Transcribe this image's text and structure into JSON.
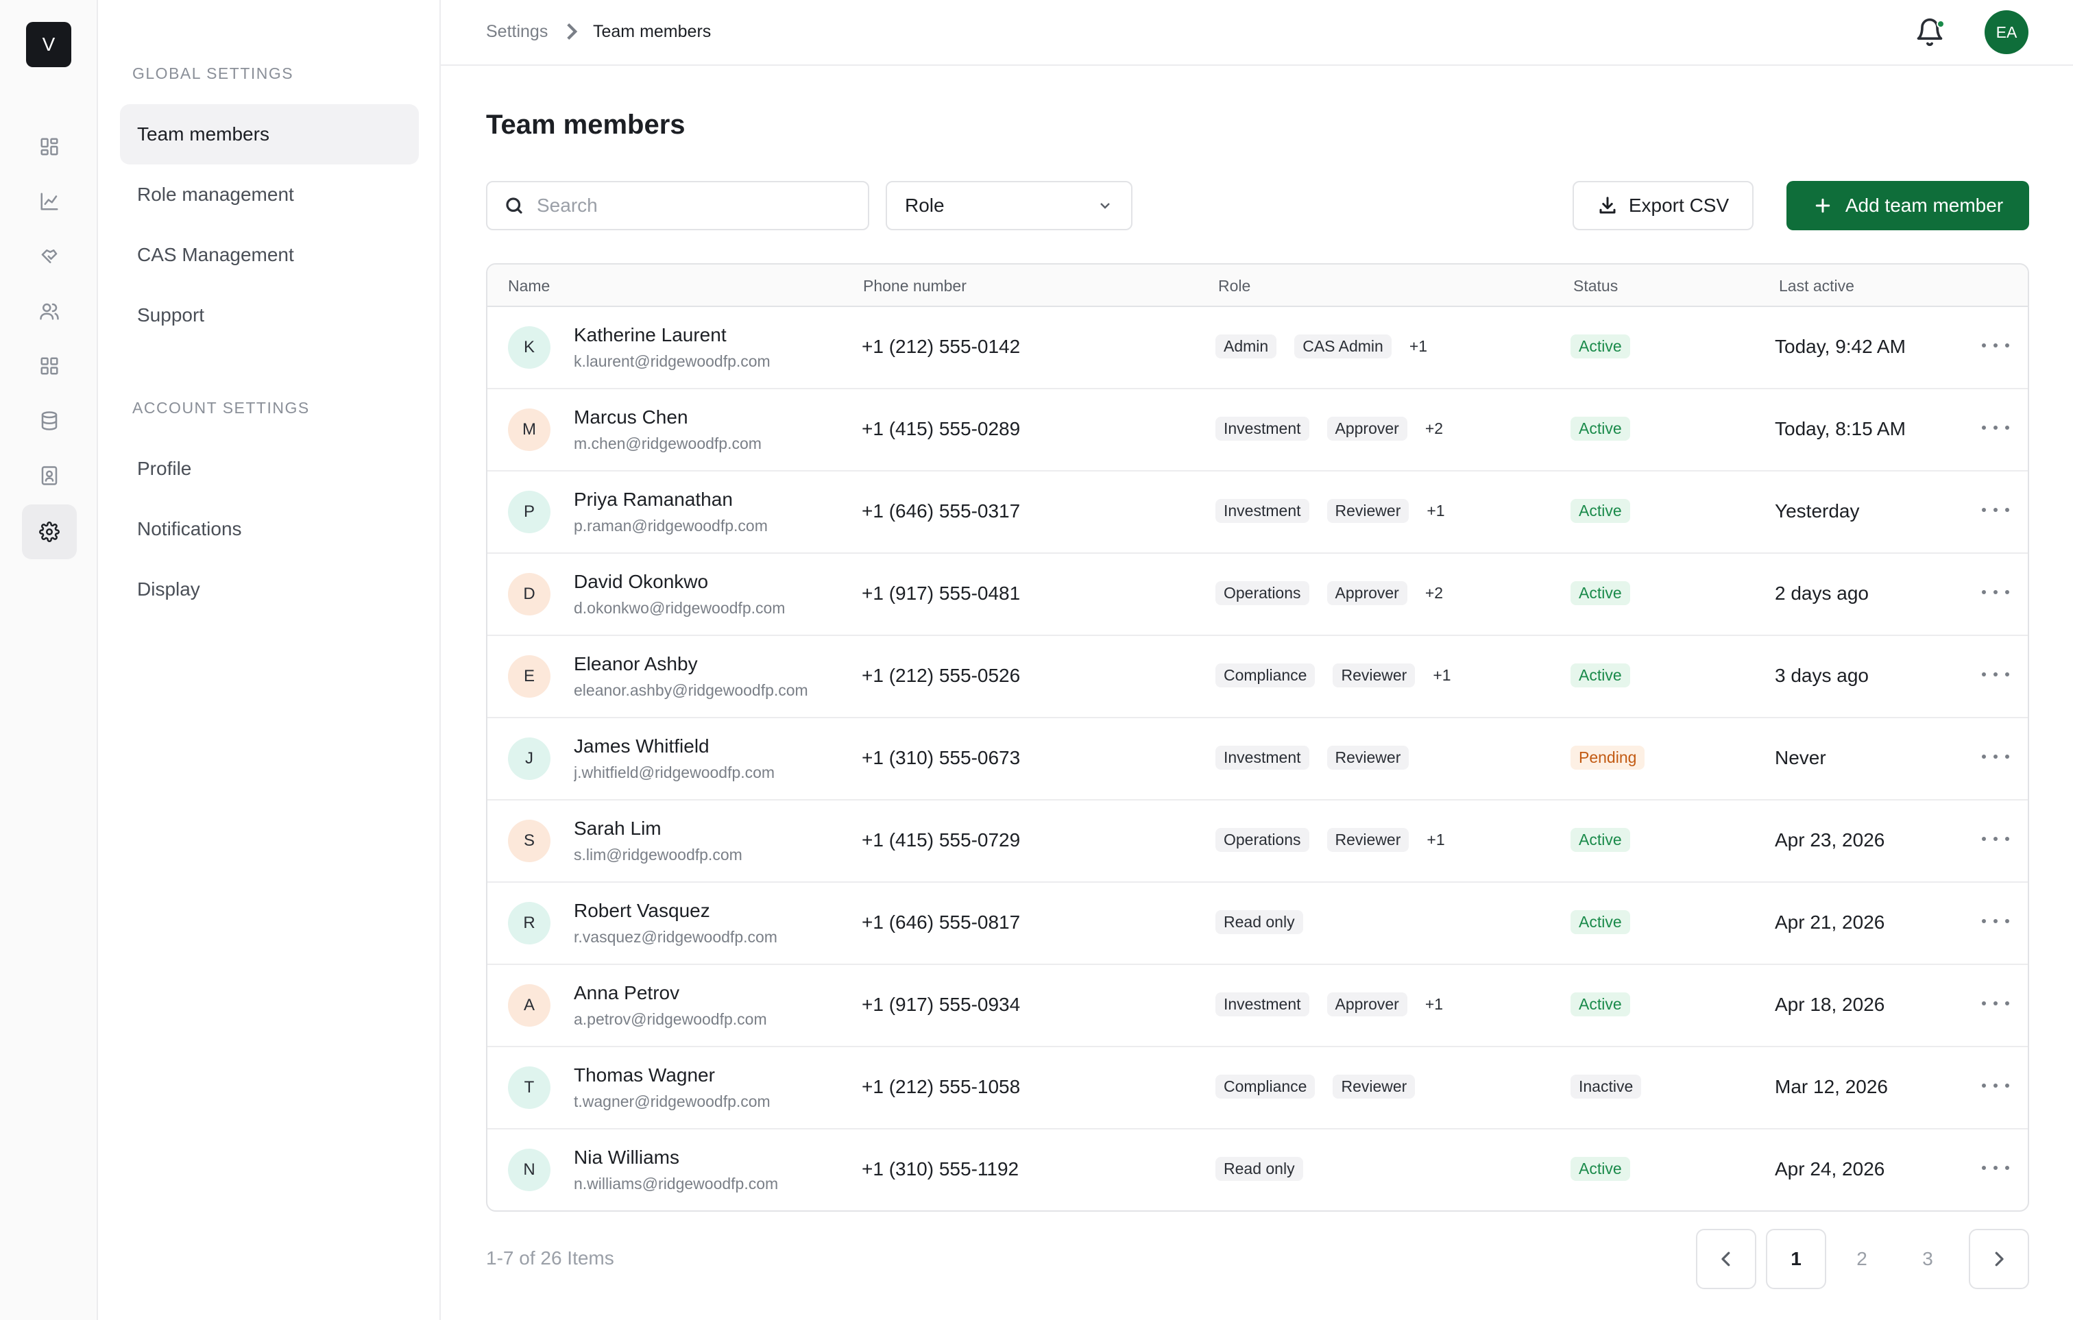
{
  "app": {
    "logo_letter": "V"
  },
  "rail": [
    {
      "icon": "dashboard-icon"
    },
    {
      "icon": "chart-icon"
    },
    {
      "icon": "handshake-icon"
    },
    {
      "icon": "users-icon"
    },
    {
      "icon": "grid-icon"
    },
    {
      "icon": "database-icon"
    },
    {
      "icon": "contacts-icon"
    },
    {
      "icon": "gear-icon",
      "active": true
    }
  ],
  "sidebar": {
    "global_label": "GLOBAL SETTINGS",
    "global_items": [
      {
        "label": "Team members",
        "active": true
      },
      {
        "label": "Role management"
      },
      {
        "label": "CAS Management"
      },
      {
        "label": "Support"
      }
    ],
    "account_label": "ACCOUNT SETTINGS",
    "account_items": [
      {
        "label": "Profile"
      },
      {
        "label": "Notifications"
      },
      {
        "label": "Display"
      }
    ]
  },
  "header": {
    "breadcrumb_root": "Settings",
    "breadcrumb_current": "Team members",
    "user_initials": "EA",
    "accent_color": "#0f6e3a"
  },
  "main": {
    "title": "Team members",
    "search_placeholder": "Search",
    "role_filter": "Role",
    "export_label": "Export CSV",
    "add_label": "Add team member"
  },
  "table": {
    "columns": [
      "Name",
      "Phone number",
      "Role",
      "Status",
      "Last active"
    ],
    "rows": [
      {
        "initial": "K",
        "tone": "teal",
        "name": "Katherine Laurent",
        "email": "k.laurent@ridgewoodfp.com",
        "phone": "+1 (212) 555-0142",
        "roles": [
          "Admin",
          "CAS Admin"
        ],
        "extra": "+1",
        "status": "Active",
        "status_type": "active",
        "last_active": "Today, 9:42 AM"
      },
      {
        "initial": "M",
        "tone": "peach",
        "name": "Marcus Chen",
        "email": "m.chen@ridgewoodfp.com",
        "phone": "+1 (415) 555-0289",
        "roles": [
          "Investment",
          "Approver"
        ],
        "extra": "+2",
        "status": "Active",
        "status_type": "active",
        "last_active": "Today, 8:15 AM"
      },
      {
        "initial": "P",
        "tone": "teal",
        "name": "Priya Ramanathan",
        "email": "p.raman@ridgewoodfp.com",
        "phone": "+1 (646) 555-0317",
        "roles": [
          "Investment",
          "Reviewer"
        ],
        "extra": "+1",
        "status": "Active",
        "status_type": "active",
        "last_active": "Yesterday"
      },
      {
        "initial": "D",
        "tone": "peach",
        "name": "David Okonkwo",
        "email": "d.okonkwo@ridgewoodfp.com",
        "phone": "+1 (917) 555-0481",
        "roles": [
          "Operations",
          "Approver"
        ],
        "extra": "+2",
        "status": "Active",
        "status_type": "active",
        "last_active": "2 days ago"
      },
      {
        "initial": "E",
        "tone": "peach",
        "name": "Eleanor Ashby",
        "email": "eleanor.ashby@ridgewoodfp.com",
        "phone": "+1 (212) 555-0526",
        "roles": [
          "Compliance",
          "Reviewer"
        ],
        "extra": "+1",
        "status": "Active",
        "status_type": "active",
        "last_active": "3 days ago"
      },
      {
        "initial": "J",
        "tone": "teal",
        "name": "James Whitfield",
        "email": "j.whitfield@ridgewoodfp.com",
        "phone": "+1 (310) 555-0673",
        "roles": [
          "Investment",
          "Reviewer"
        ],
        "extra": "",
        "status": "Pending",
        "status_type": "pending",
        "last_active": "Never"
      },
      {
        "initial": "S",
        "tone": "peach",
        "name": "Sarah Lim",
        "email": "s.lim@ridgewoodfp.com",
        "phone": "+1 (415) 555-0729",
        "roles": [
          "Operations",
          "Reviewer"
        ],
        "extra": "+1",
        "status": "Active",
        "status_type": "active",
        "last_active": "Apr 23, 2026"
      },
      {
        "initial": "R",
        "tone": "teal",
        "name": "Robert Vasquez",
        "email": "r.vasquez@ridgewoodfp.com",
        "phone": "+1 (646) 555-0817",
        "roles": [
          "Read only"
        ],
        "extra": "",
        "status": "Active",
        "status_type": "active",
        "last_active": "Apr 21, 2026"
      },
      {
        "initial": "A",
        "tone": "peach",
        "name": "Anna Petrov",
        "email": "a.petrov@ridgewoodfp.com",
        "phone": "+1 (917) 555-0934",
        "roles": [
          "Investment",
          "Approver"
        ],
        "extra": "+1",
        "status": "Active",
        "status_type": "active",
        "last_active": "Apr 18, 2026"
      },
      {
        "initial": "T",
        "tone": "teal",
        "name": "Thomas Wagner",
        "email": "t.wagner@ridgewoodfp.com",
        "phone": "+1 (212) 555-1058",
        "roles": [
          "Compliance",
          "Reviewer"
        ],
        "extra": "",
        "status": "Inactive",
        "status_type": "inactive",
        "last_active": "Mar 12, 2026"
      },
      {
        "initial": "N",
        "tone": "teal",
        "name": "Nia Williams",
        "email": "n.williams@ridgewoodfp.com",
        "phone": "+1 (310) 555-1192",
        "roles": [
          "Read only"
        ],
        "extra": "",
        "status": "Active",
        "status_type": "active",
        "last_active": "Apr 24, 2026"
      }
    ]
  },
  "pagination": {
    "range_text": "1-7 of 26 Items",
    "pages": [
      "1",
      "2",
      "3"
    ],
    "current": "1"
  }
}
